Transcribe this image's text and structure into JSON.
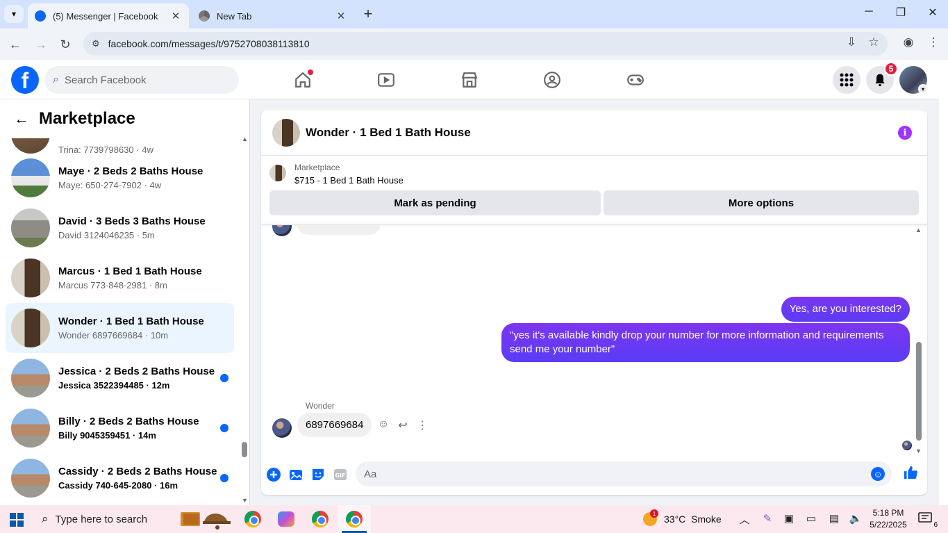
{
  "browser": {
    "tabs": [
      {
        "title": "(5) Messenger | Facebook",
        "active": true
      },
      {
        "title": "New Tab",
        "active": false
      }
    ],
    "url": "facebook.com/messages/t/9752708038113810"
  },
  "fb": {
    "search_placeholder": "Search Facebook",
    "notification_count": "5"
  },
  "sidebar": {
    "title": "Marketplace",
    "partial_item_sub": "Trina: 7739798630 · 4w",
    "conversations": [
      {
        "name": "Maye · 2 Beds 2 Baths House",
        "sub": "Maye: 650-274-7902 · 4w",
        "unread": false,
        "selected": false
      },
      {
        "name": "David · 3 Beds 3 Baths House",
        "sub": "David 3124046235 · 5m",
        "unread": false,
        "selected": false
      },
      {
        "name": "Marcus · 1 Bed 1 Bath House",
        "sub": "Marcus 773-848-2981 · 8m",
        "unread": false,
        "selected": false
      },
      {
        "name": "Wonder · 1 Bed 1 Bath House",
        "sub": "Wonder 6897669684 · 10m",
        "unread": false,
        "selected": true
      },
      {
        "name": "Jessica · 2 Beds 2 Baths House",
        "sub": "Jessica 3522394485 · 12m",
        "unread": true,
        "selected": false
      },
      {
        "name": "Billy · 2 Beds 2 Baths House",
        "sub": "Billy 9045359451 · 14m",
        "unread": true,
        "selected": false
      },
      {
        "name": "Cassidy · 2 Beds 2 Baths House",
        "sub": "Cassidy 740-645-2080 · 16m",
        "unread": true,
        "selected": false
      }
    ]
  },
  "chat": {
    "title": "Wonder · 1 Bed 1 Bath House",
    "marketplace_label": "Marketplace",
    "listing": "$715 - 1 Bed 1 Bath House",
    "mark_pending": "Mark as pending",
    "more_options": "More options",
    "messages_out": [
      "Yes, are you interested?",
      "\"yes it's available kindly drop your number for more information and requirements send me your number\""
    ],
    "sender_name": "Wonder",
    "message_in": "6897669684",
    "composer_placeholder": "Aa"
  },
  "taskbar": {
    "search_placeholder": "Type here to search",
    "weather": "33°C  Smoke",
    "weather_badge": "1",
    "time": "5:18 PM",
    "date": "5/22/2025",
    "notif_count": "6"
  },
  "colors": {
    "fb_blue": "#0866ff",
    "bubble": "#6236ff",
    "selected_row": "#ebf5ff",
    "badge_red": "#e41e3f"
  }
}
